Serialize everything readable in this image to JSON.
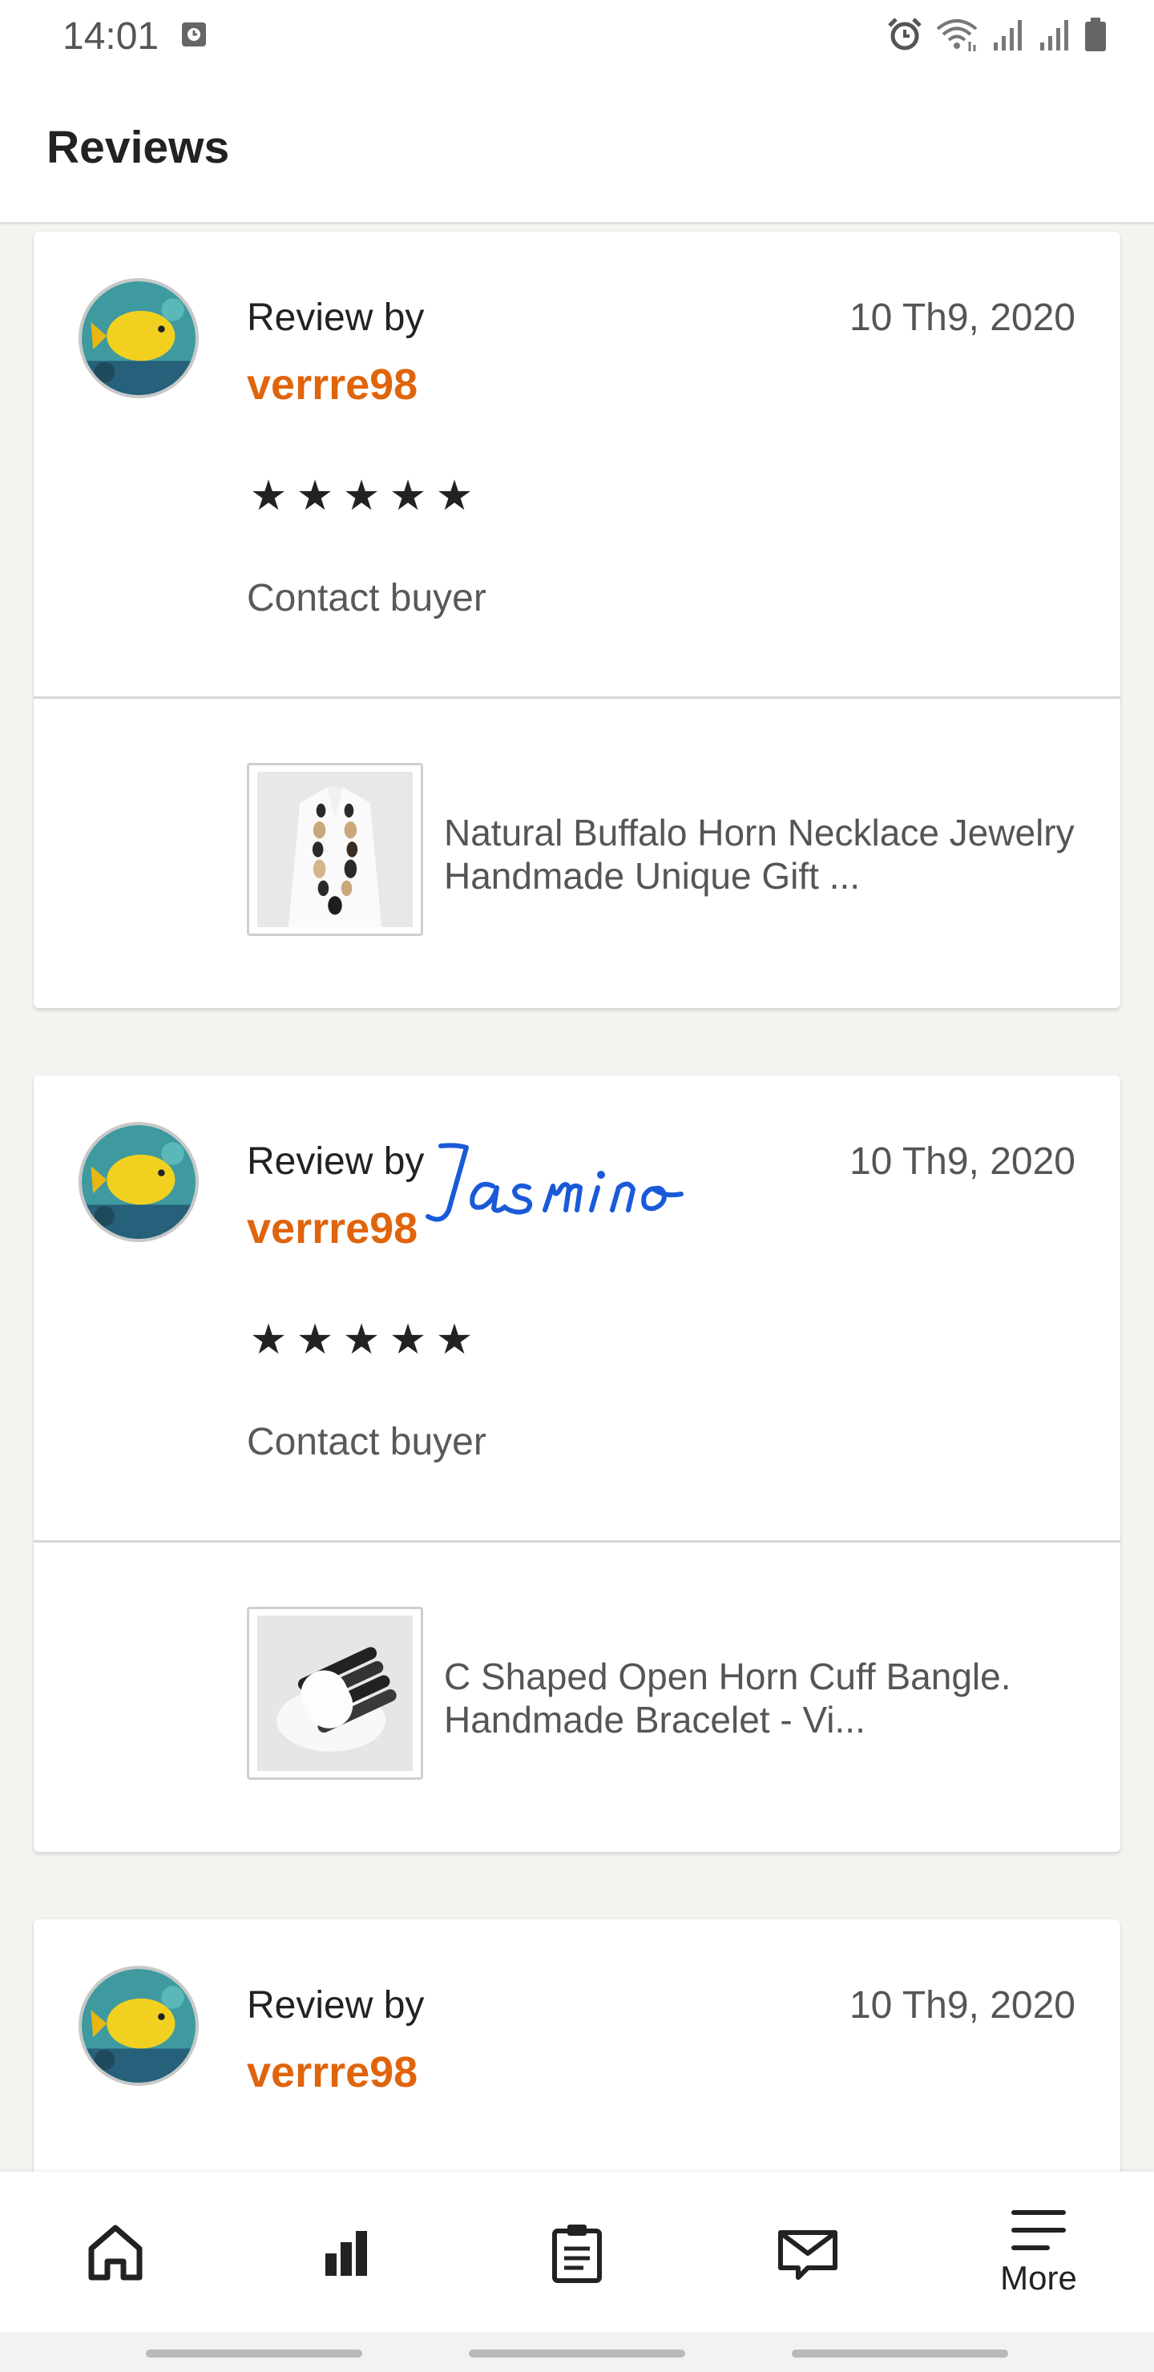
{
  "status_bar": {
    "time": "14:01",
    "icons": [
      "calendar-icon",
      "alarm-icon",
      "wifi-icon",
      "signal-icon",
      "signal-icon",
      "battery-icon"
    ]
  },
  "header": {
    "title": "Reviews"
  },
  "reviews": [
    {
      "review_by": "Review by",
      "reviewer": "verrre98",
      "date": "10 Th9, 2020",
      "stars": [
        "★",
        "★",
        "★",
        "★",
        "★"
      ],
      "rating": 5,
      "contact": "Contact buyer",
      "product_title": "Natural Buffalo Horn Necklace Jewelry Handmade Unique Gift ...",
      "product_icon": "necklace-thumbnail"
    },
    {
      "review_by": "Review by",
      "reviewer": "verrre98",
      "date": "10 Th9, 2020",
      "stars": [
        "★",
        "★",
        "★",
        "★",
        "★"
      ],
      "rating": 5,
      "contact": "Contact buyer",
      "product_title": "C Shaped Open Horn Cuff Bangle. Handmade Bracelet - Vi...",
      "product_icon": "bracelet-thumbnail"
    },
    {
      "review_by": "Review by",
      "reviewer": "verrre98",
      "date": "10 Th9, 2020"
    }
  ],
  "signature": {
    "text": "Jasmino",
    "color": "#1a5ad8"
  },
  "bottom_nav": {
    "items": [
      {
        "icon": "home-icon",
        "label": ""
      },
      {
        "icon": "stats-icon",
        "label": ""
      },
      {
        "icon": "clipboard-icon",
        "label": ""
      },
      {
        "icon": "mail-icon",
        "label": ""
      },
      {
        "icon": "menu-icon",
        "label": "More"
      }
    ]
  },
  "colors": {
    "accent": "#e0640c",
    "background": "#f4f3f0",
    "text": "#222222"
  }
}
